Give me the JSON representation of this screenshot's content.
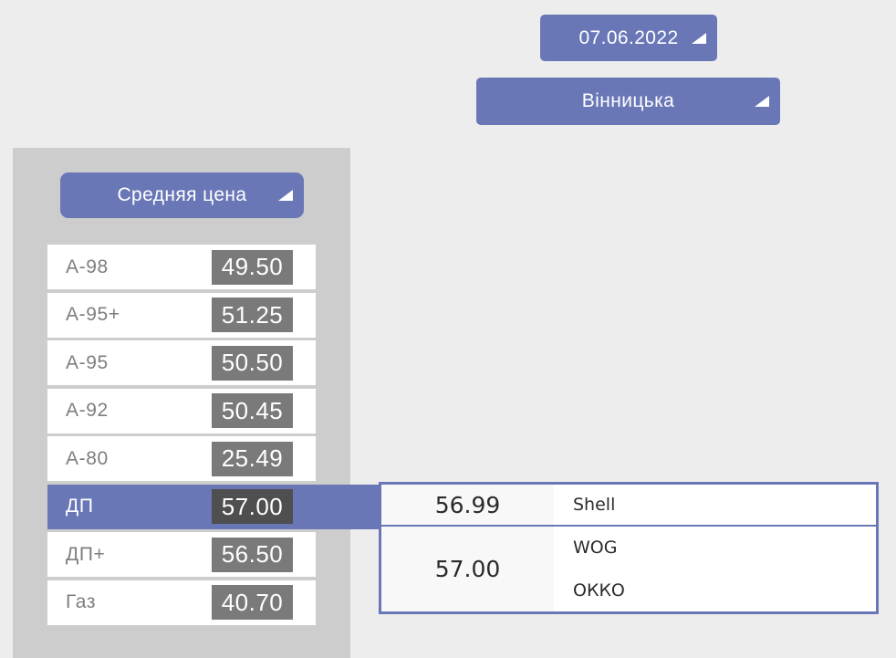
{
  "filters": {
    "date": {
      "label": "07.06.2022"
    },
    "region": {
      "label": "Вінницька"
    }
  },
  "price_panel": {
    "metric_label": "Средняя цена",
    "fuels": [
      {
        "name": "А-98",
        "price": "49.50",
        "selected": false
      },
      {
        "name": "А-95+",
        "price": "51.25",
        "selected": false
      },
      {
        "name": "А-95",
        "price": "50.50",
        "selected": false
      },
      {
        "name": "А-92",
        "price": "50.45",
        "selected": false
      },
      {
        "name": "А-80",
        "price": "25.49",
        "selected": false
      },
      {
        "name": "ДП",
        "price": "57.00",
        "selected": true
      },
      {
        "name": "ДП+",
        "price": "56.50",
        "selected": false
      },
      {
        "name": "Газ",
        "price": "40.70",
        "selected": false
      }
    ]
  },
  "brand_table": {
    "rows": [
      {
        "price": "56.99",
        "brands": [
          "Shell"
        ]
      },
      {
        "price": "57.00",
        "brands": [
          "WOG",
          "ОККО"
        ]
      }
    ]
  },
  "colors": {
    "accent": "#6a77b7",
    "badge": "#7a7a7a",
    "badge_selected": "#4f4f4f",
    "panel_gray": "#cdcdcd",
    "background": "#ededed",
    "fuel_label": "#7e7e7e",
    "detail_text": "#2b2b2b",
    "price_cell_bg": "#f8f8f8"
  }
}
